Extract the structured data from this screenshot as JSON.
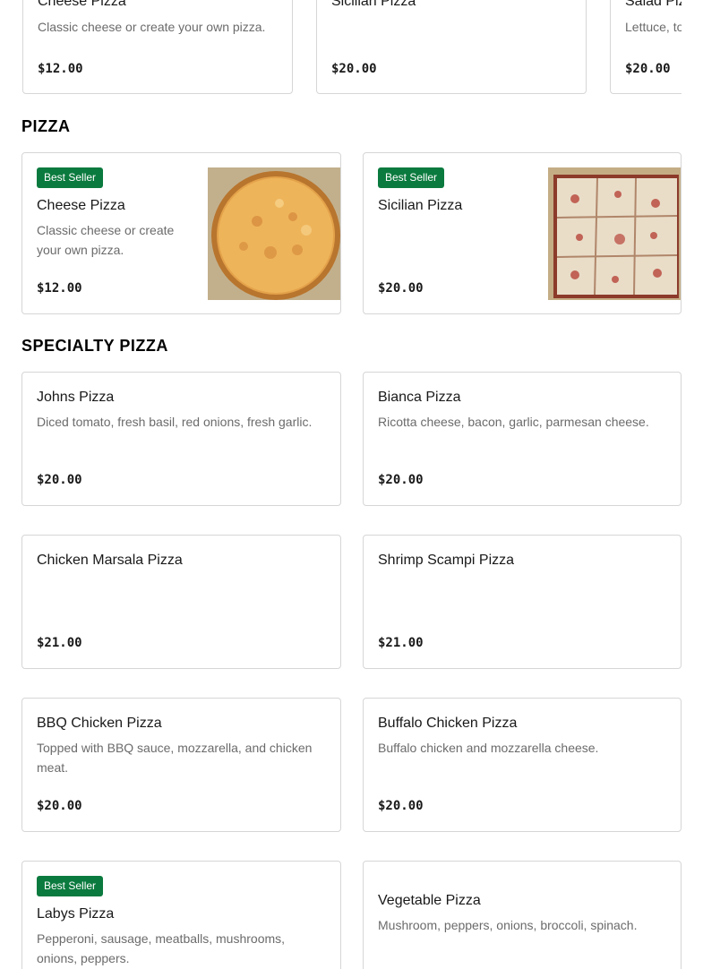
{
  "top_row": [
    {
      "name": "Cheese Pizza",
      "desc": "Classic cheese or create your own pizza.",
      "price": "$12.00"
    },
    {
      "name": "Sicilian Pizza",
      "desc": "",
      "price": "$20.00"
    },
    {
      "name": "Salad Pizza",
      "desc": "Lettuce, to",
      "price": "$20.00"
    }
  ],
  "sections": [
    {
      "title": "PIZZA",
      "items": [
        {
          "badge": "Best Seller",
          "name": "Cheese Pizza",
          "desc": "Classic cheese or create your own pizza.",
          "price": "$12.00",
          "image": "cheese-pizza-photo"
        },
        {
          "badge": "Best Seller",
          "name": "Sicilian Pizza",
          "desc": "",
          "price": "$20.00",
          "image": "sicilian-pizza-photo"
        }
      ]
    },
    {
      "title": "SPECIALTY PIZZA",
      "items": [
        {
          "name": "Johns Pizza",
          "desc": "Diced tomato, fresh basil, red onions, fresh garlic.",
          "price": "$20.00"
        },
        {
          "name": "Bianca Pizza",
          "desc": "Ricotta cheese, bacon, garlic, parmesan cheese.",
          "price": "$20.00"
        },
        {
          "name": "Chicken Marsala Pizza",
          "desc": "",
          "price": "$21.00"
        },
        {
          "name": "Shrimp Scampi Pizza",
          "desc": "",
          "price": "$21.00"
        },
        {
          "name": "BBQ Chicken Pizza",
          "desc": "Topped with BBQ sauce, mozzarella, and chicken meat.",
          "price": "$20.00"
        },
        {
          "name": "Buffalo Chicken Pizza",
          "desc": "Buffalo chicken and mozzarella cheese.",
          "price": "$20.00"
        },
        {
          "badge": "Best Seller",
          "name": "Labys Pizza",
          "desc": "Pepperoni, sausage, meatballs, mushrooms, onions, peppers.",
          "price": ""
        },
        {
          "name": "Vegetable Pizza",
          "desc": "Mushroom, peppers, onions, broccoli, spinach.",
          "price": ""
        }
      ]
    }
  ],
  "colors": {
    "badge_bg": "#0b7a3e",
    "border": "#d6d6d6",
    "desc_text": "#6b6b6b"
  }
}
